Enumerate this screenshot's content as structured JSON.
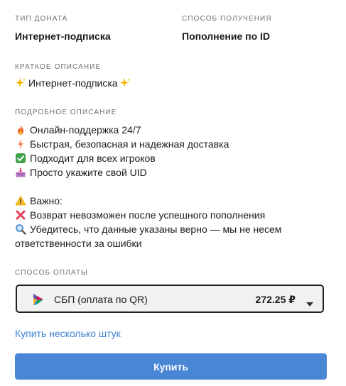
{
  "donation_type": {
    "label": "ТИП ДОНАТА",
    "value": "Интернет-подписка"
  },
  "receive_method": {
    "label": "СПОСОБ ПОЛУЧЕНИЯ",
    "value": "Пополнение по ID"
  },
  "short_description": {
    "label": "КРАТКОЕ ОПИСАНИЕ",
    "text": "Интернет-подписка",
    "icon": "sparkles-icon"
  },
  "detailed_description": {
    "label": "ПОДРОБНОЕ ОПИСАНИЕ",
    "lines": [
      {
        "icon": "fire-icon",
        "text": "Онлайн-поддержка 24/7"
      },
      {
        "icon": "lightning-icon",
        "text": "Быстрая, безопасная и надежная доставка"
      },
      {
        "icon": "check-mark-icon",
        "text": "Подходит для всех игроков"
      },
      {
        "icon": "inbox-tray-icon",
        "text": "Просто укажите свой UID"
      }
    ],
    "important_title": {
      "icon": "warning-icon",
      "text": "Важно:"
    },
    "important_lines": [
      {
        "icon": "cross-mark-icon",
        "text": "Возврат невозможен после успешного пополнения"
      },
      {
        "icon": "magnifier-icon",
        "text": "Убедитесь, что данные указаны верно — мы не несем"
      },
      {
        "icon": "",
        "text": "ответственности за ошибки"
      }
    ]
  },
  "payment": {
    "label": "СПОСОБ ОПЛАТЫ",
    "selected_method": "СБП (оплата по QR)",
    "price": "272.25 ₽",
    "logo_icon": "sbp-logo-icon",
    "caret_icon": "caret-down-icon"
  },
  "buy_multiple_link": "Купить несколько штук",
  "buy_button": "Купить",
  "colors": {
    "accent": "#4a86d6",
    "link": "#3c7fd2",
    "caption": "#6e6e6e",
    "text": "#1b1b1b"
  }
}
